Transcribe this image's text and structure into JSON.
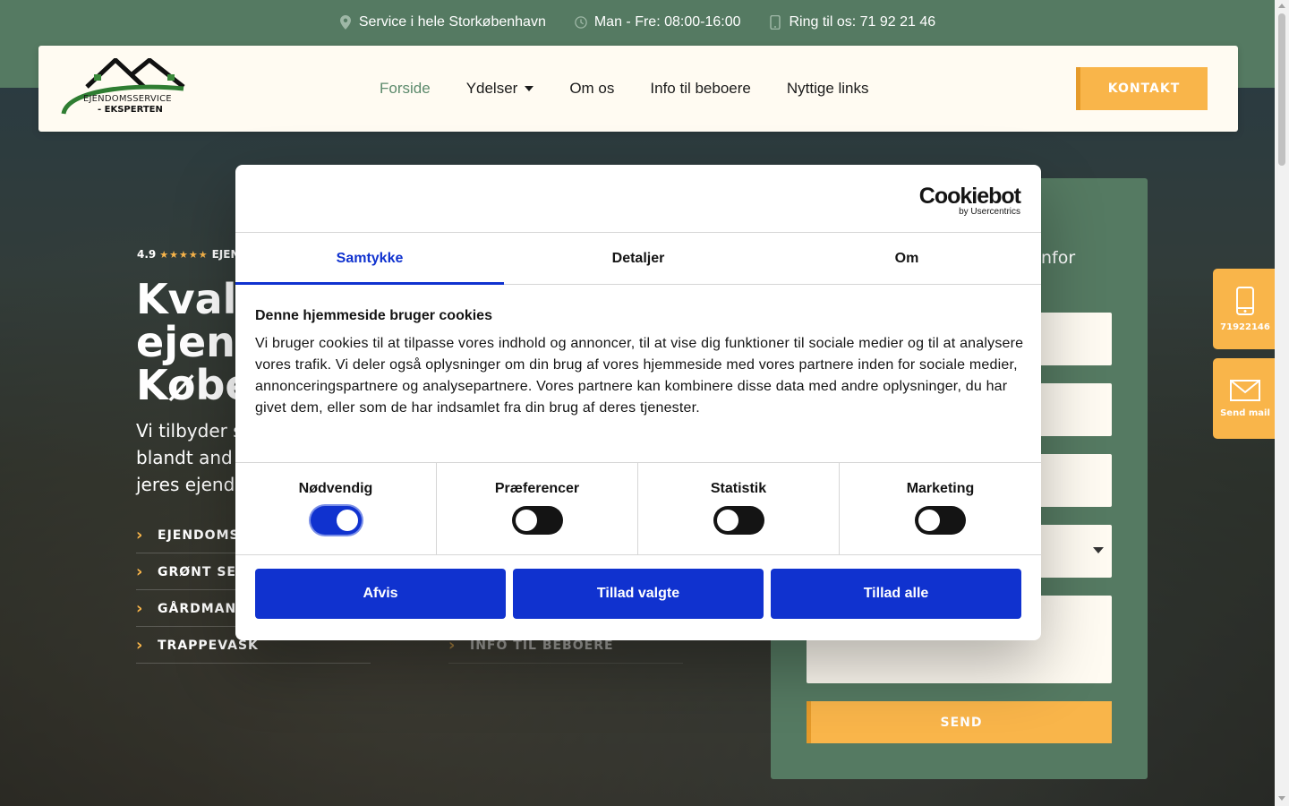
{
  "topbar": {
    "service": "Service i hele Storkøbenhavn",
    "hours": "Man - Fre: 08:00-16:00",
    "phone": "Ring til os: 71 92 21 46"
  },
  "logo": {
    "line1": "EJENDOMSSERVICE",
    "line2": "- EKSPERTEN"
  },
  "nav": {
    "items": [
      "Forside",
      "Ydelser",
      "Om os",
      "Info til beboere",
      "Nyttige links"
    ],
    "cta": "KONTAKT"
  },
  "hero": {
    "rating": "4.9",
    "stars": "★★★★★",
    "rating_label": "EJEN",
    "title": [
      "Kvali",
      "ejend",
      "Købe"
    ],
    "subtitle": [
      "Vi tilbyder s",
      "blandt and",
      "jeres ejend"
    ],
    "links": [
      "EJENDOMS",
      "GRØNT SER",
      "GÅRDMAN",
      "TRAPPEVASK",
      "INFO TIL BEBOERE"
    ]
  },
  "form": {
    "title_fragment": "nfor",
    "send": "SEND"
  },
  "float": {
    "phone_label": "71922146",
    "mail_label": "Send mail"
  },
  "cookie": {
    "brand": "Cookiebot",
    "brand_sub": "by Usercentrics",
    "tabs": [
      "Samtykke",
      "Detaljer",
      "Om"
    ],
    "active_tab": "Samtykke",
    "title": "Denne hjemmeside bruger cookies",
    "text": "Vi bruger cookies til at tilpasse vores indhold og annoncer, til at vise dig funktioner til sociale medier og til at analysere vores trafik. Vi deler også oplysninger om din brug af vores hjemmeside med vores partnere inden for sociale medier, annonceringspartnere og analysepartnere. Vores partnere kan kombinere disse data med andre oplysninger, du har givet dem, eller som de har indsamlet fra din brug af deres tjenester.",
    "toggles": [
      {
        "label": "Nødvendig",
        "on": true
      },
      {
        "label": "Præferencer",
        "on": false
      },
      {
        "label": "Statistik",
        "on": false
      },
      {
        "label": "Marketing",
        "on": false
      }
    ],
    "buttons": [
      "Afvis",
      "Tillad valgte",
      "Tillad alle"
    ]
  },
  "colors": {
    "brand_green": "#557a62",
    "accent_orange": "#f9b54a",
    "cookie_blue": "#1032cf"
  }
}
